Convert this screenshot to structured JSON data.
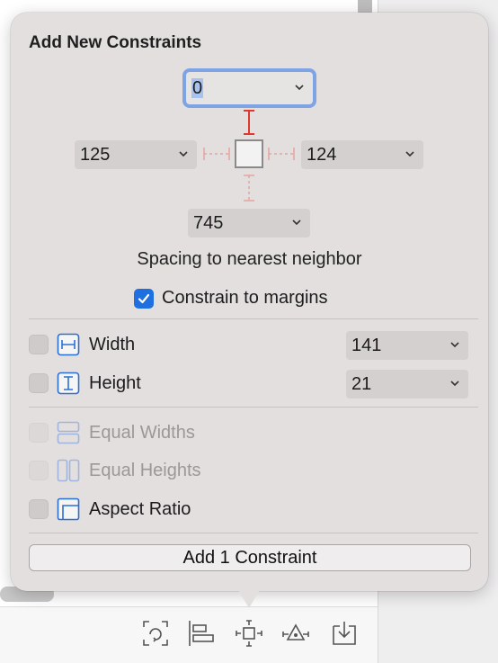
{
  "popover": {
    "title": "Add New Constraints",
    "top_value": "0",
    "left_value": "125",
    "right_value": "124",
    "bottom_value": "745",
    "spacing_label": "Spacing to nearest neighbor",
    "constrain_margins": {
      "label": "Constrain to margins",
      "checked": true
    },
    "width": {
      "label": "Width",
      "value": "141",
      "checked": false
    },
    "height": {
      "label": "Height",
      "value": "21",
      "checked": false
    },
    "equal_widths": {
      "label": "Equal Widths",
      "enabled": false
    },
    "equal_heights": {
      "label": "Equal Heights",
      "enabled": false
    },
    "aspect_ratio": {
      "label": "Aspect Ratio",
      "checked": false
    },
    "add_button_label": "Add 1 Constraint"
  },
  "colors": {
    "accent": "#1f6fe0",
    "focus_ring": "#7fa4e6",
    "constraint_active": "#e0392b",
    "constraint_inactive": "#e8a3a0",
    "icon_blue": "#2b6fd6"
  },
  "toolbar_icons": [
    "update-frames-icon",
    "align-icon",
    "add-constraints-icon",
    "resolve-issues-icon",
    "embed-in-icon"
  ]
}
